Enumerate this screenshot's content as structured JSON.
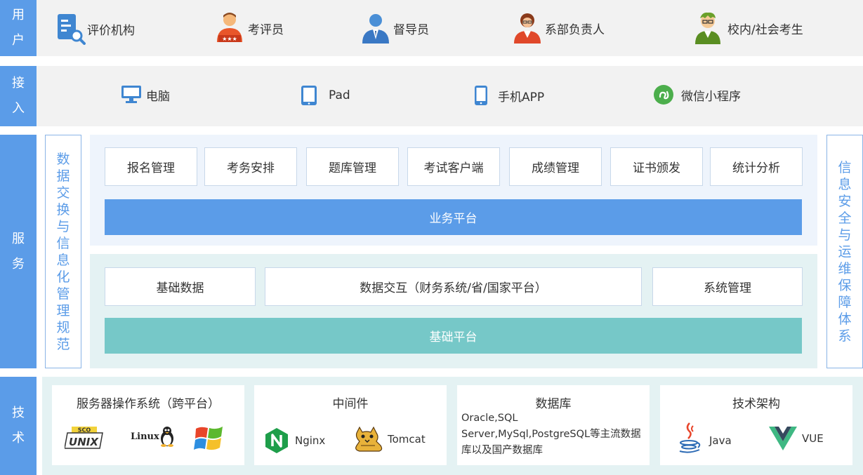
{
  "sections": {
    "user": "用户",
    "access": "接入",
    "service": "服务",
    "tech": "技术"
  },
  "users": [
    {
      "label": "评价机构",
      "icon": "document-search-icon"
    },
    {
      "label": "考评员",
      "icon": "evaluator-person-icon"
    },
    {
      "label": "督导员",
      "icon": "supervisor-person-icon"
    },
    {
      "label": "系部负责人",
      "icon": "department-head-person-icon"
    },
    {
      "label": "校内/社会考生",
      "icon": "student-person-icon"
    }
  ],
  "access": [
    {
      "label": "电脑",
      "icon": "monitor-icon"
    },
    {
      "label": "Pad",
      "icon": "tablet-icon"
    },
    {
      "label": "手机APP",
      "icon": "phone-icon"
    },
    {
      "label": "微信小程序",
      "icon": "wechat-miniprogram-icon"
    }
  ],
  "left_vertical": "数据交换与信息化管理规范",
  "right_vertical": "信息安全与运维保障体系",
  "business": {
    "modules": [
      "报名管理",
      "考务安排",
      "题库管理",
      "考试客户端",
      "成绩管理",
      "证书颁发",
      "统计分析"
    ],
    "platform": "业务平台"
  },
  "foundation": {
    "modules": [
      "基础数据",
      "数据交互（财务系统/省/国家平台）",
      "系统管理"
    ],
    "platform": "基础平台"
  },
  "tech": {
    "os": {
      "title": "服务器操作系统（跨平台）",
      "logos": [
        "UNIX",
        "Linux",
        "windows-logo-icon"
      ],
      "logo_top": "SCO"
    },
    "middleware": {
      "title": "中间件",
      "logos": [
        "Nginx",
        "Tomcat"
      ]
    },
    "database": {
      "title": "数据库",
      "desc": "Oracle,SQL Server,MySql,PostgreSQL等主流数据库以及国产数据库"
    },
    "framework": {
      "title": "技术架构",
      "logos": [
        "Java",
        "VUE"
      ]
    }
  },
  "colors": {
    "sidebar": "#5b9ce8",
    "business_bar": "#5b9ce8",
    "foundation_bar": "#76c8c8",
    "panel_blue": "#eef4fc",
    "panel_mint": "#e4f2f3"
  }
}
